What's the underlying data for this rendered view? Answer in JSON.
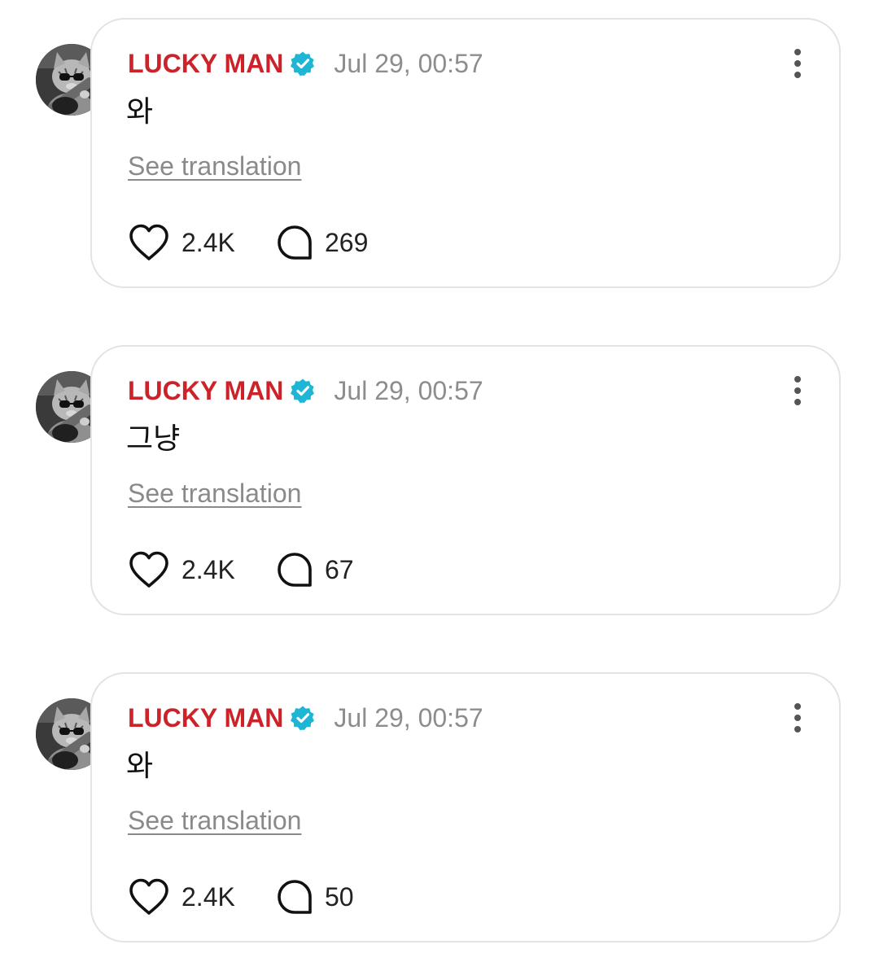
{
  "posts": [
    {
      "author": "LUCKY MAN",
      "timestamp": "Jul 29, 00:57",
      "text": "와",
      "translation_link": "See translation",
      "likes": "2.4K",
      "replies": "269"
    },
    {
      "author": "LUCKY MAN",
      "timestamp": "Jul 29, 00:57",
      "text": "그냥",
      "translation_link": "See translation",
      "likes": "2.4K",
      "replies": "67"
    },
    {
      "author": "LUCKY MAN",
      "timestamp": "Jul 29, 00:57",
      "text": "와",
      "translation_link": "See translation",
      "likes": "2.4K",
      "replies": "50"
    }
  ],
  "icons": {
    "verified": "verified-badge-icon",
    "more": "more-vertical-icon",
    "like": "heart-icon",
    "reply": "comment-bubble-icon"
  },
  "colors": {
    "author": "#cc2229",
    "verified_badge": "#1fb6d6",
    "timestamp": "#8d8d8d",
    "card_border": "#e3e3e3"
  }
}
